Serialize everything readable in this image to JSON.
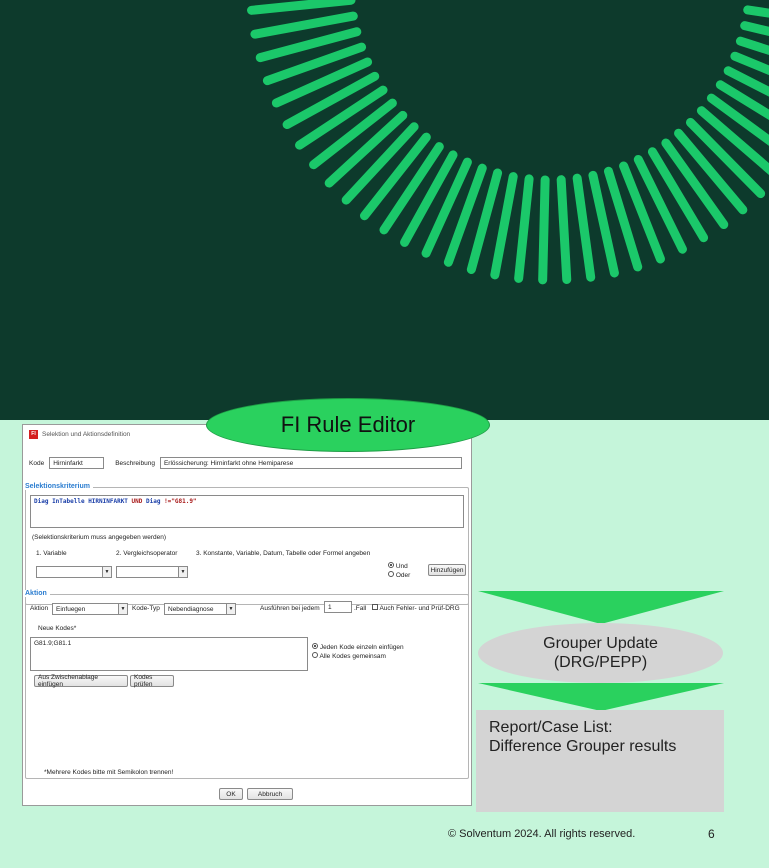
{
  "hero": {
    "accent_color": "#1bc86a",
    "background_color": "#0d3a2c"
  },
  "pill_editor": {
    "label": "FI Rule Editor"
  },
  "dialog": {
    "app_icon_text": "FI",
    "title": "Selektion und Aktionsdefinition",
    "kode_label": "Kode",
    "kode_value": "Hirninfarkt",
    "beschreibung_label": "Beschreibung",
    "beschreibung_value": "Erlössicherung: Hirninfarkt ohne Hemiparese",
    "selektion": {
      "title": "Selektionskriterium",
      "expr": {
        "t1": "Diag ",
        "t2": "InTabelle ",
        "t3": "HIRNINFARKT ",
        "t4": "UND ",
        "t5": "Diag ",
        "t6": "!=\"G81.9\""
      },
      "hint": "(Selektionskriterium muss angegeben werden)",
      "col1": "1. Variable",
      "col2": "2. Vergleichsoperator",
      "col3": "3. Konstante, Variable, Datum, Tabelle oder Formel angeben",
      "radio_und": "Und",
      "radio_oder": "Oder",
      "add_button": "Hinzufügen"
    },
    "aktion": {
      "title": "Aktion",
      "aktion_label": "Aktion",
      "aktion_value": "Einfuegen",
      "kodetyp_label": "Kode-Typ",
      "kodetyp_value": "Nebendiagnose",
      "ausfuehren_label": "Ausführen bei jedem",
      "ausfuehren_value": "1",
      "fall_label": ".Fall",
      "auch_label": "Auch Fehler- und Prüf-DRG",
      "neue_kodes_label": "Neue Kodes*",
      "neue_kodes_value": "G81.9;G81.1",
      "radio_einzeln": "Jeden Kode einzeln einfügen",
      "radio_gemeinsam": "Alle Kodes gemeinsam",
      "paste_button": "Aus Zwischenablage einfügen",
      "check_button": "Kodes prüfen",
      "note": "*Mehrere Kodes bitte mit Semikolon trennen!"
    },
    "ok_button": "OK",
    "cancel_button": "Abbruch"
  },
  "flow": {
    "grouper_line1": "Grouper Update",
    "grouper_line2": "(DRG/PEPP)",
    "report_line1": "Report/Case List:",
    "report_line2": "Difference Grouper results"
  },
  "footer": {
    "copyright": "© Solventum 2024. All rights reserved.",
    "page": "6"
  }
}
